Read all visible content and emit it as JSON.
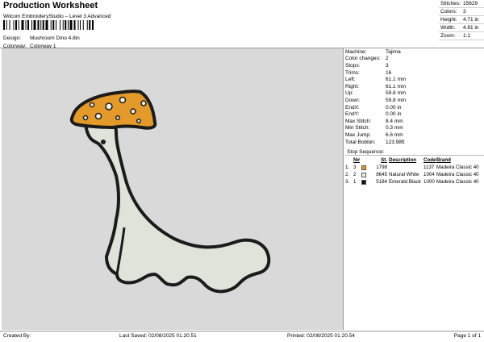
{
  "header": {
    "title": "Production Worksheet",
    "subtitle": "Wilcom EmbroideryStudio – Level 3 Advanced"
  },
  "stats": [
    {
      "label": "Stitches:",
      "value": "15629"
    },
    {
      "label": "Colors:",
      "value": "3"
    },
    {
      "label": "Height:",
      "value": "4.71 in"
    },
    {
      "label": "Width:",
      "value": "4.81 in"
    },
    {
      "label": "Zoom:",
      "value": "1:1"
    }
  ],
  "meta": [
    {
      "label": "Design:",
      "value": "Mushroom Dino 4.8in"
    },
    {
      "label": "Colorway:",
      "value": "Colorway 1"
    }
  ],
  "details": [
    {
      "label": "Machine:",
      "value": "Tajima"
    },
    {
      "label": "Color changes:",
      "value": "2"
    },
    {
      "label": "Stops:",
      "value": "3"
    },
    {
      "label": "Trims:",
      "value": "16"
    },
    {
      "label": "Left:",
      "value": "61.1 mm"
    },
    {
      "label": "Right:",
      "value": "61.1 mm"
    },
    {
      "label": "Up:",
      "value": "59.8 mm"
    },
    {
      "label": "Down:",
      "value": "59.8 mm"
    },
    {
      "label": "EndX:",
      "value": "0.00 in"
    },
    {
      "label": "EndY:",
      "value": "0.00 in"
    },
    {
      "label": "Max Stitch:",
      "value": "8.4 mm"
    },
    {
      "label": "Min Stitch:",
      "value": "0.3 mm"
    },
    {
      "label": "Max Jump:",
      "value": "6.6 mm"
    },
    {
      "label": "Total Bobbin:",
      "value": "123.98ft"
    }
  ],
  "sequence": {
    "title": "Stop Sequence:",
    "headers": {
      "n": "N#",
      "st": "St.",
      "desc": "Description",
      "code": "Code",
      "brand": "Brand"
    },
    "rows": [
      {
        "idx": "1.",
        "n": "3",
        "color": "#e39a2b",
        "st": "1798",
        "desc": "",
        "code": "1137",
        "brand": "Madeira Classic 40"
      },
      {
        "idx": "2.",
        "n": "2",
        "color": "#eef0e4",
        "st": "8645",
        "desc": "Natural White",
        "code": "1004",
        "brand": "Madeira Classic 40"
      },
      {
        "idx": "3.",
        "n": "1",
        "color": "#111111",
        "st": "5184",
        "desc": "Emerald Black",
        "code": "1000",
        "brand": "Madeira Classic 40"
      }
    ]
  },
  "footer": {
    "created_by": "Created By:",
    "last_saved": "Last Saved: 02/08/2025 01.20.51",
    "printed": "Printed: 02/08/2025 01.20.54",
    "page": "Page 1 of 1"
  },
  "design_colors": {
    "body_fill": "#dfe3da",
    "cap_fill": "#e39a2b",
    "outline": "#1b1b1b",
    "canvas_bg": "#d9d9d9"
  }
}
